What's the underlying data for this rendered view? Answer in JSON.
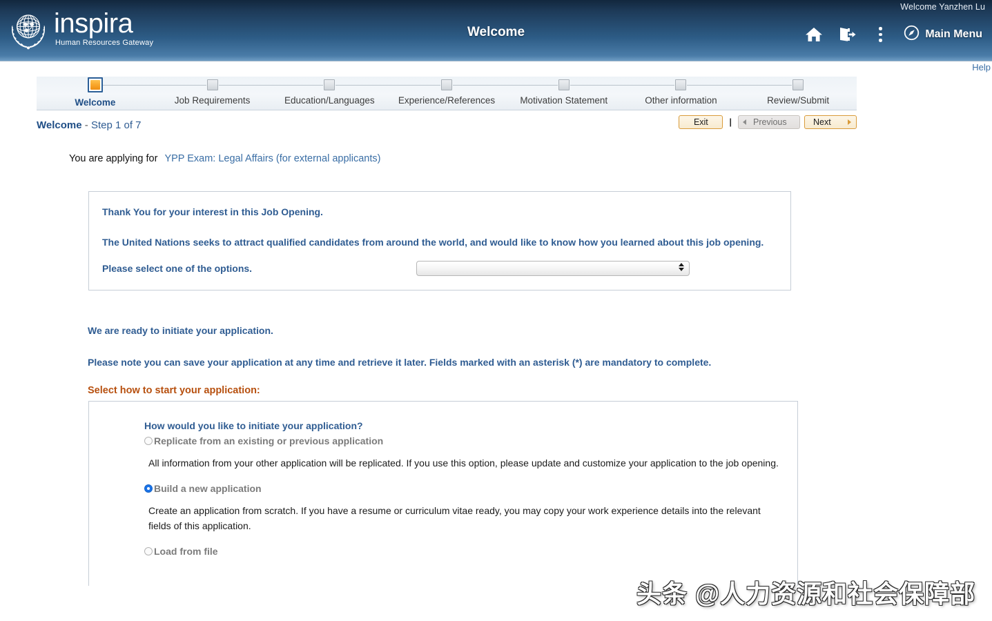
{
  "header": {
    "welcome_user": "Welcome Yanzhen Lu",
    "brand_name": "inspira",
    "brand_tagline": "Human Resources Gateway",
    "title": "Welcome",
    "icons": {
      "home": "home-icon",
      "signout": "sign-out-icon",
      "more": "three-dots-icon",
      "compass": "compass-icon"
    },
    "main_menu_label": "Main Menu"
  },
  "help": {
    "label": "Help"
  },
  "stepper": {
    "steps": [
      {
        "label": "Welcome",
        "active": true
      },
      {
        "label": "Job Requirements",
        "active": false
      },
      {
        "label": "Education/Languages",
        "active": false
      },
      {
        "label": "Experience/References",
        "active": false
      },
      {
        "label": "Motivation Statement",
        "active": false
      },
      {
        "label": "Other information",
        "active": false
      },
      {
        "label": "Review/Submit",
        "active": false
      }
    ]
  },
  "subhead": {
    "step_name": "Welcome",
    "separator": " - ",
    "step_counter": "Step 1 of 7",
    "buttons": {
      "exit": "Exit",
      "divider": "|",
      "previous": "Previous",
      "next": "Next"
    }
  },
  "applying": {
    "prefix": "You are applying for",
    "job_title": "YPP Exam: Legal Affairs (for external applicants)"
  },
  "panel": {
    "thanks": "Thank You for your interest in this Job Opening.",
    "seek": "The United Nations seeks to attract qualified candidates from around the world, and would like to know how you learned about this job opening.",
    "select_label": "Please select one of the options.",
    "select_value": "",
    "select_placeholder": ""
  },
  "body_text": {
    "ready": "We are ready to initiate your application.",
    "note": "Please note you can save your application at any time and retrieve it later. Fields marked with an asterisk (*) are mandatory to complete.",
    "select_start": "Select how to start your application:"
  },
  "initiate": {
    "heading": "How would you like to initiate your application?",
    "options": [
      {
        "label": "Replicate from an existing or previous application",
        "selected": false,
        "description": "All information from your other application will be replicated. If you use this option, please update and customize your application to the job opening."
      },
      {
        "label": "Build a new application",
        "selected": true,
        "description": "Create an application from scratch. If you have a resume or curriculum vitae ready, you may copy your work experience details into the relevant fields of this application."
      },
      {
        "label": "Load from file",
        "selected": false,
        "description": ""
      }
    ]
  },
  "watermark": {
    "text": "头条 @人力资源和社会保障部"
  },
  "colors": {
    "header_dark": "#12273d",
    "header_light": "#6f9dc4",
    "accent_blue": "#2f5c92",
    "link_blue": "#3a6ea5",
    "accent_orange": "#f9a62b",
    "button_border": "#d99b3a",
    "section_title_brown": "#b7500f",
    "radio_selected": "#1a73e8"
  }
}
